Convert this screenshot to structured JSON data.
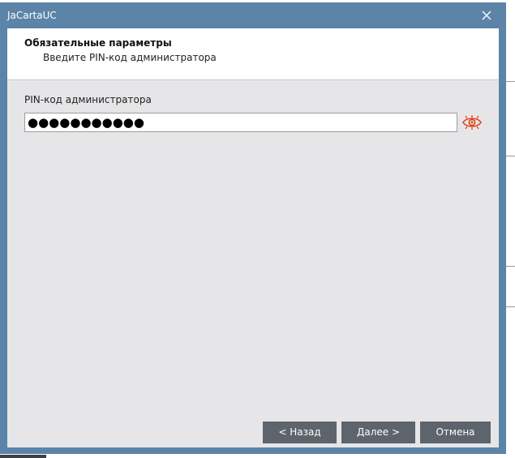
{
  "window": {
    "title": "JaCartaUC"
  },
  "header": {
    "title": "Обязательные параметры",
    "subtitle": "Введите PIN-код администратора"
  },
  "form": {
    "pin_label": "PIN-код администратора",
    "pin_value": "●●●●●●●●●●●",
    "pin_masked": true
  },
  "buttons": {
    "back": "< Назад",
    "next": "Далее >",
    "cancel": "Отмена"
  },
  "icons": {
    "close": "close-icon",
    "show_password": "eye-icon"
  },
  "colors": {
    "titlebar": "#5b84a8",
    "button": "#5e646b",
    "eye_icon": "#e0431a"
  }
}
